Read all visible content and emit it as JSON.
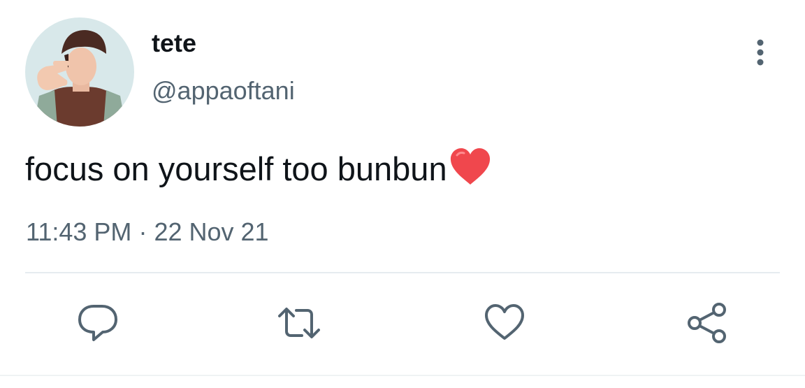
{
  "tweet": {
    "author": {
      "display_name": "tete",
      "handle": "@appaoftani"
    },
    "text": "focus on yourself too bunbun",
    "emoji": "red-heart",
    "time": "11:43 PM",
    "separator": "·",
    "date": "22 Nov 21"
  },
  "actions": {
    "reply_icon": "speech-bubble",
    "retweet_icon": "retweet-arrows",
    "like_icon": "heart-outline",
    "share_icon": "share-nodes"
  },
  "colors": {
    "text": "#0f1419",
    "secondary": "#536471",
    "heart_emoji": "#f0474d"
  }
}
